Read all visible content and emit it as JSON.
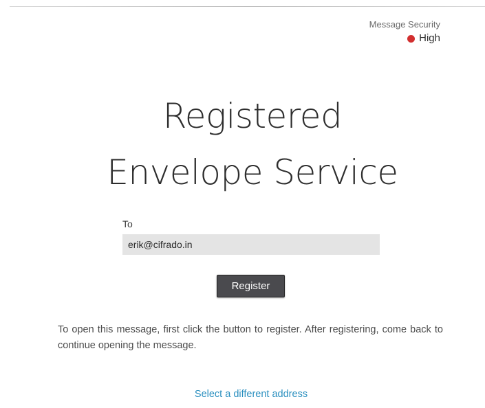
{
  "security": {
    "label": "Message Security",
    "level": "High",
    "indicator_color": "#d22f2f",
    "indicator_icon": "status-dot-icon"
  },
  "header": {
    "title_line1": "Registered",
    "title_line2": "Envelope Service"
  },
  "recipient": {
    "label": "To",
    "value": "erik@cifrado.in"
  },
  "actions": {
    "register_label": "Register",
    "select_address_label": "Select a different address"
  },
  "instructions": "To open this message, first click the button to register. After registering, come back to continue opening the message.",
  "colors": {
    "link": "#2a8fbf",
    "button_bg": "#4a4a4e",
    "field_bg": "#e4e4e4"
  }
}
